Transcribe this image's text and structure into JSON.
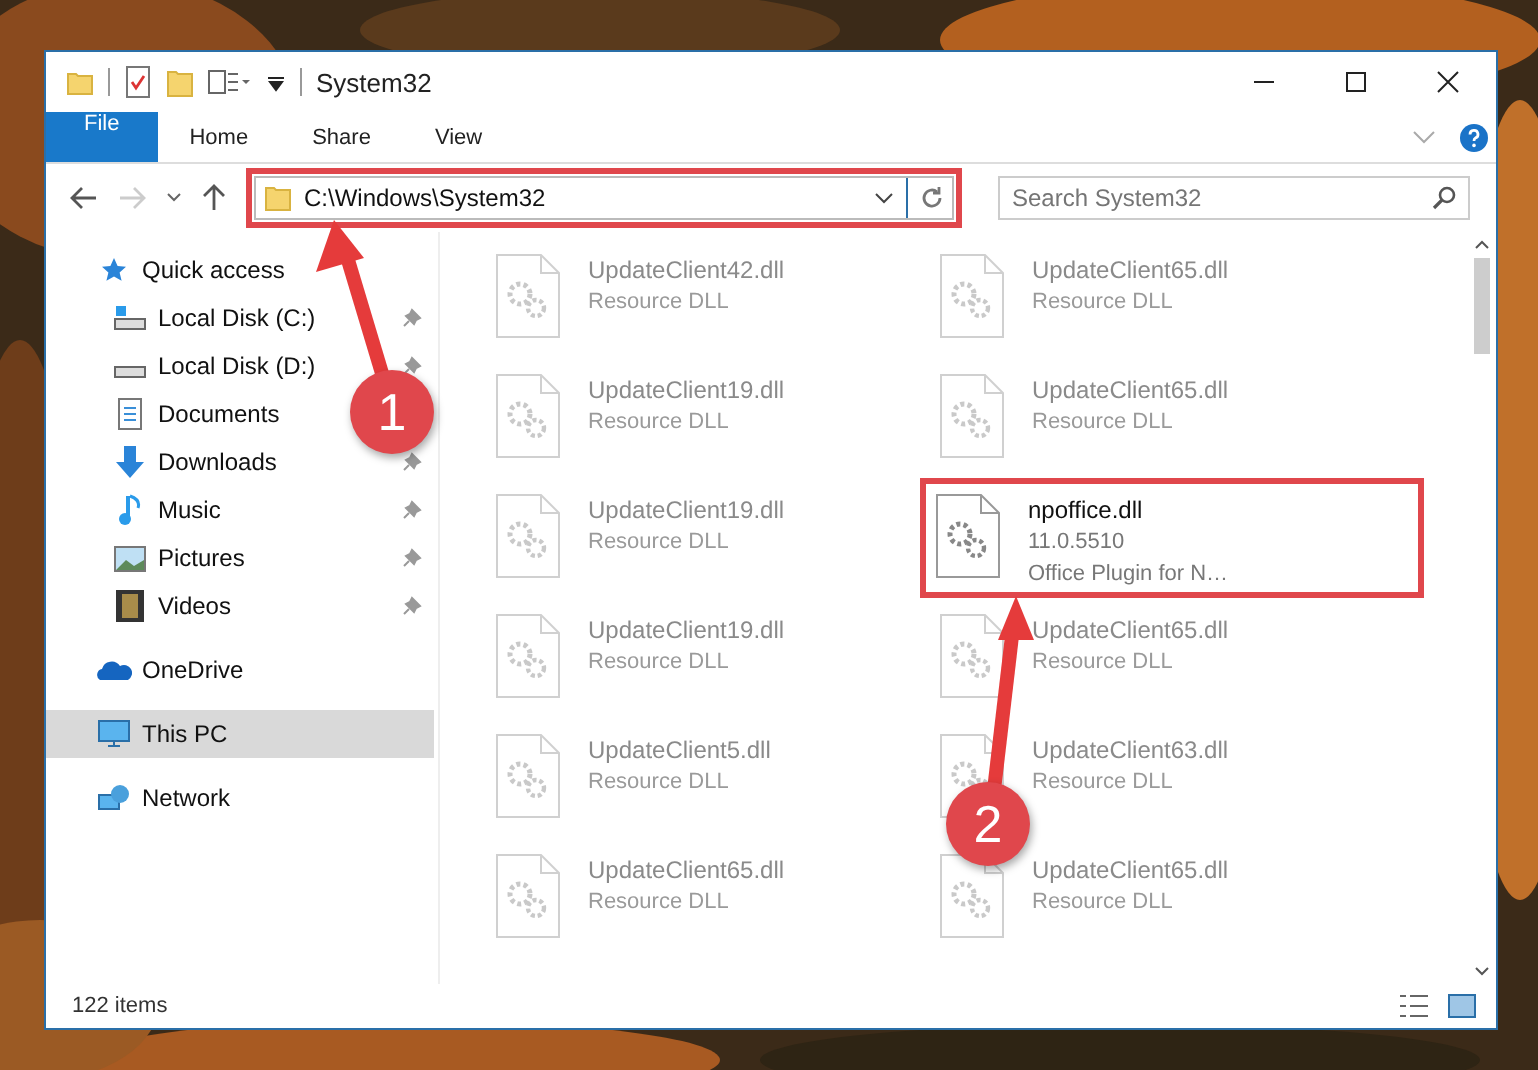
{
  "window": {
    "title": "System32"
  },
  "ribbon_tabs": [
    {
      "label": "File",
      "kind": "file"
    },
    {
      "label": "Home",
      "kind": "tab"
    },
    {
      "label": "Share",
      "kind": "tab"
    },
    {
      "label": "View",
      "kind": "tab"
    }
  ],
  "address_bar": {
    "path": "C:\\Windows\\System32"
  },
  "search": {
    "placeholder": "Search System32"
  },
  "navigation": [
    {
      "label": "Quick access",
      "kind": "star",
      "selected": false,
      "children": [
        {
          "label": "Local Disk (C:)",
          "kind": "drive-win",
          "pinned": true
        },
        {
          "label": "Local Disk (D:)",
          "kind": "drive",
          "pinned": true
        },
        {
          "label": "Documents",
          "kind": "documents",
          "pinned": false
        },
        {
          "label": "Downloads",
          "kind": "downloads",
          "pinned": true
        },
        {
          "label": "Music",
          "kind": "music",
          "pinned": true
        },
        {
          "label": "Pictures",
          "kind": "pictures",
          "pinned": true
        },
        {
          "label": "Videos",
          "kind": "videos",
          "pinned": true
        }
      ]
    },
    {
      "label": "OneDrive",
      "kind": "cloud",
      "selected": false
    },
    {
      "label": "This PC",
      "kind": "pc",
      "selected": true
    },
    {
      "label": "Network",
      "kind": "network",
      "selected": false
    }
  ],
  "files": [
    {
      "kind": "blurred",
      "name": "UpdateClient42.dll",
      "type": "Resource DLL"
    },
    {
      "kind": "blurred",
      "name": "UpdateClient65.dll",
      "type": "Resource DLL"
    },
    {
      "kind": "blurred",
      "name": "UpdateClient19.dll",
      "type": "Resource DLL"
    },
    {
      "kind": "blurred",
      "name": "UpdateClient65.dll",
      "type": "Resource DLL"
    },
    {
      "kind": "blurred",
      "name": "UpdateClient19.dll",
      "type": "Resource DLL"
    },
    {
      "kind": "clear",
      "name": "npoffice.dll",
      "version": "11.0.5510",
      "description": "Office Plugin for N…"
    },
    {
      "kind": "blurred",
      "name": "UpdateClient19.dll",
      "type": "Resource DLL"
    },
    {
      "kind": "blurred",
      "name": "UpdateClient65.dll",
      "type": "Resource DLL"
    },
    {
      "kind": "blurred",
      "name": "UpdateClient5.dll",
      "type": "Resource DLL"
    },
    {
      "kind": "blurred",
      "name": "UpdateClient63.dll",
      "type": "Resource DLL"
    },
    {
      "kind": "blurred",
      "name": "UpdateClient65.dll",
      "type": "Resource DLL"
    },
    {
      "kind": "blurred",
      "name": "UpdateClient65.dll",
      "type": "Resource DLL"
    }
  ],
  "status_bar": {
    "count": "122 items"
  },
  "annotations": [
    {
      "number": "1"
    },
    {
      "number": "2"
    }
  ]
}
